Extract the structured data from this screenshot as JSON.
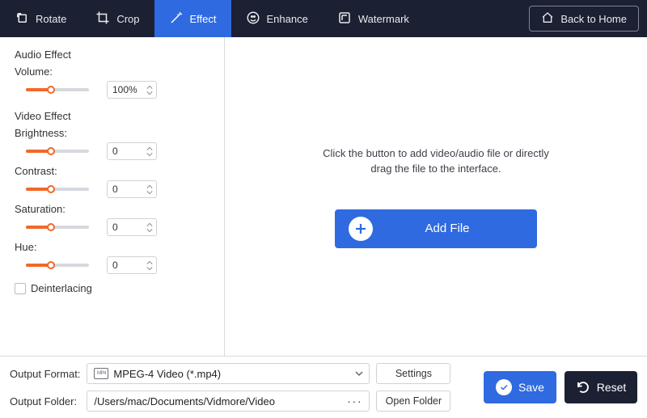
{
  "toolbar": {
    "rotate": "Rotate",
    "crop": "Crop",
    "effect": "Effect",
    "enhance": "Enhance",
    "watermark": "Watermark",
    "back": "Back to Home"
  },
  "side": {
    "audio_title": "Audio Effect",
    "volume_label": "Volume:",
    "volume_value": "100%",
    "video_title": "Video Effect",
    "brightness_label": "Brightness:",
    "brightness_value": "0",
    "contrast_label": "Contrast:",
    "contrast_value": "0",
    "saturation_label": "Saturation:",
    "saturation_value": "0",
    "hue_label": "Hue:",
    "hue_value": "0",
    "deinterlacing": "Deinterlacing"
  },
  "drop": {
    "hint_line1": "Click the button to add video/audio file or directly",
    "hint_line2": "drag the file to the interface.",
    "add_file": "Add File"
  },
  "bottom": {
    "format_label": "Output Format:",
    "format_value": "MPEG-4 Video (*.mp4)",
    "settings": "Settings",
    "folder_label": "Output Folder:",
    "folder_value": "/Users/mac/Documents/Vidmore/Video",
    "open_folder": "Open Folder",
    "save": "Save",
    "reset": "Reset"
  }
}
